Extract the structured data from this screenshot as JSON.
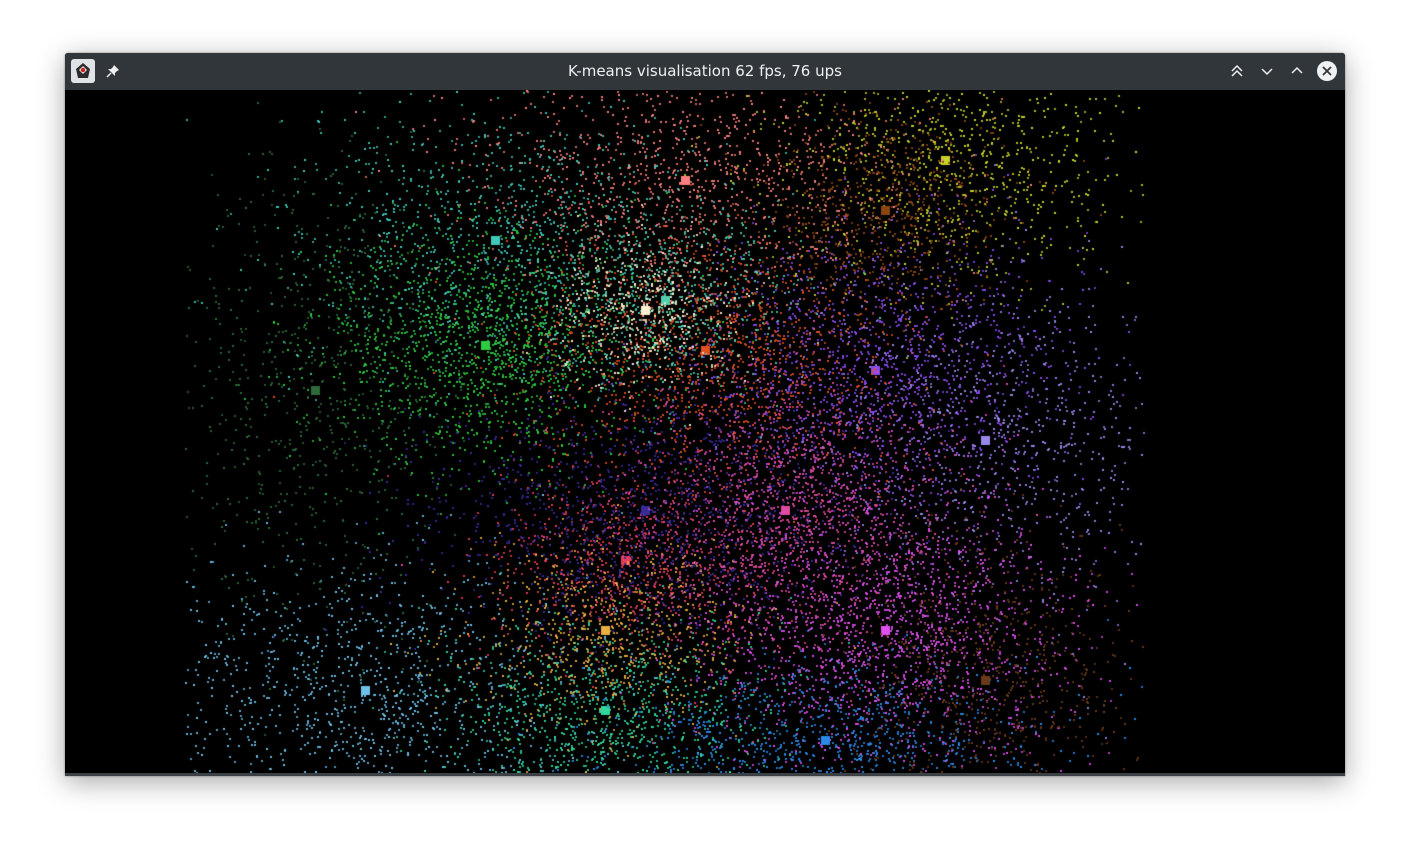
{
  "window": {
    "title": "K-means visualisation 62 fps, 76 ups"
  },
  "titlebar_icons": {
    "app": "java-app-icon",
    "pin": "pin-icon",
    "keep_above": "keep-above-icon",
    "minimize": "minimize-icon",
    "maximize": "maximize-icon",
    "close": "close-icon"
  },
  "colors": {
    "titlebar": "#31363b",
    "title_text": "#eff0f1",
    "canvas_background": "#000000"
  },
  "clusters": [
    {
      "color": "#c8d428"
    },
    {
      "color": "#2ecc40"
    },
    {
      "color": "#fa8080"
    },
    {
      "color": "#e63c5a"
    },
    {
      "color": "#8a4cf0"
    },
    {
      "color": "#9a88e8"
    },
    {
      "color": "#6fc0e8"
    },
    {
      "color": "#e050f0"
    },
    {
      "color": "#30d8a0"
    },
    {
      "color": "#e8b040"
    },
    {
      "color": "#2a8ae8"
    },
    {
      "color": "#6a3a1a"
    },
    {
      "color": "#40c8b8"
    },
    {
      "color": "#e05020"
    },
    {
      "color": "#2e6a3a"
    },
    {
      "color": "#3a2a9a"
    },
    {
      "color": "#50d0b0"
    },
    {
      "color": "#e04aa0"
    },
    {
      "color": "#fff0d0"
    },
    {
      "color": "#8b4513"
    }
  ]
}
